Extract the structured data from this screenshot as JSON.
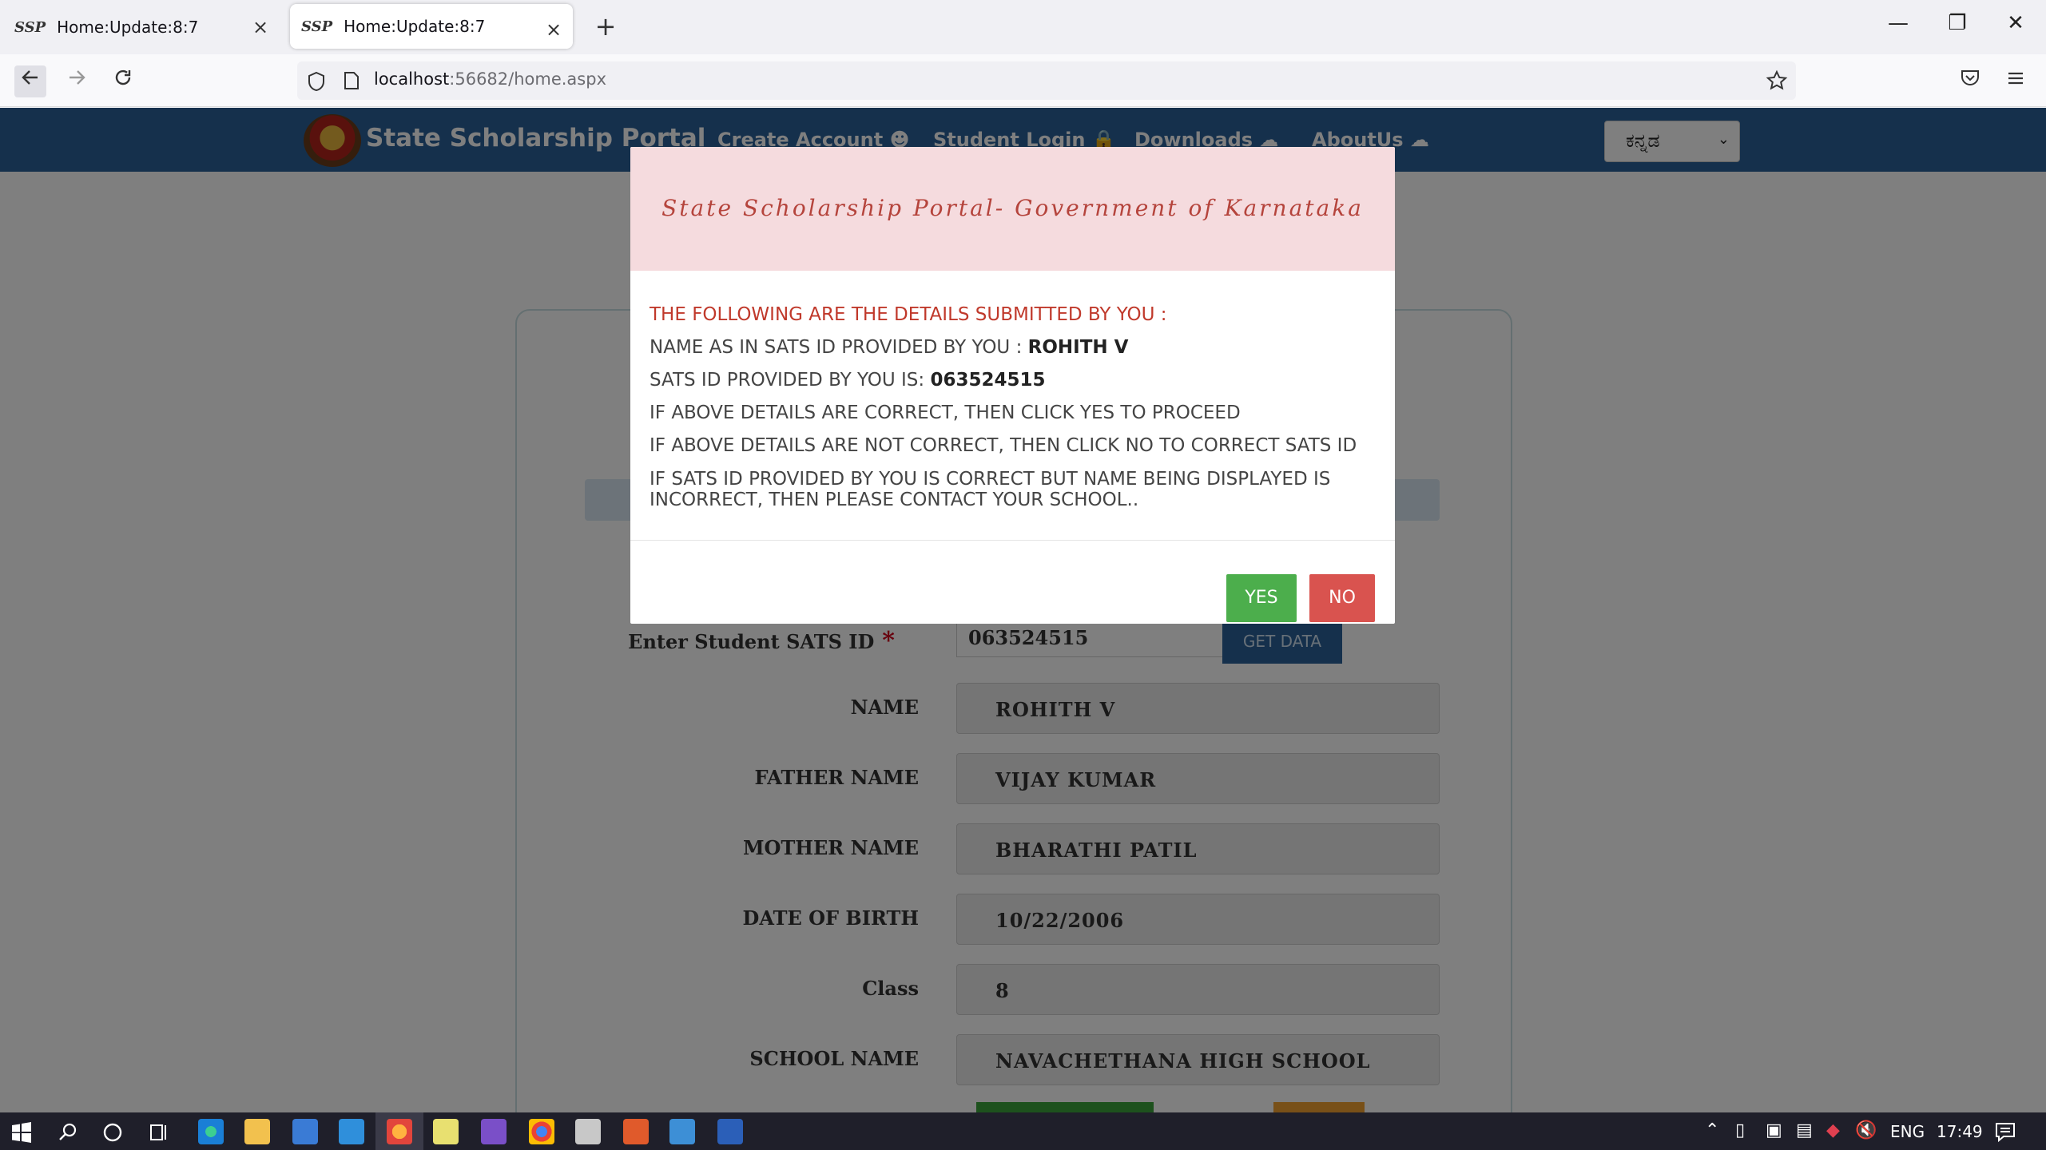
{
  "browser": {
    "tabs": [
      {
        "favicon": "SSP",
        "title": "Home:Update:8:7",
        "close": "×"
      },
      {
        "favicon": "SSP",
        "title": "Home:Update:8:7",
        "close": "×"
      }
    ],
    "new_tab": "+",
    "window": {
      "minimize": "—",
      "restore": "❐",
      "close": "✕"
    },
    "url_host": "localhost",
    "url_rest": ":56682/home.aspx"
  },
  "site": {
    "title": "State Scholarship Portal",
    "menu": [
      "Create Account",
      "Student Login",
      "Downloads",
      "AboutUs"
    ],
    "language": "ಕನ್ನಡ"
  },
  "form": {
    "sats_label": "Enter Student SATS ID",
    "required_mark": "*",
    "sats_value": "063524515",
    "get_data": "GET DATA",
    "fields": [
      {
        "label": "NAME",
        "value": "ROHITH  V"
      },
      {
        "label": "FATHER NAME",
        "value": "VIJAY KUMAR"
      },
      {
        "label": "MOTHER NAME",
        "value": "BHARATHI PATIL"
      },
      {
        "label": "DATE OF BIRTH",
        "value": "10/22/2006"
      },
      {
        "label": "Class",
        "value": "8"
      },
      {
        "label": "SCHOOL NAME",
        "value": "NAVACHETHANA HIGH SCHOOL"
      }
    ]
  },
  "modal": {
    "title": "State Scholarship Portal- Government of Karnataka",
    "line1": "THE FOLLOWING ARE THE DETAILS SUBMITTED BY YOU :",
    "line2_prefix": "NAME AS IN SATS ID PROVIDED BY YOU : ",
    "line2_value": "ROHITH V",
    "line3_prefix": "SATS ID PROVIDED BY YOU IS: ",
    "line3_value": "063524515",
    "line4": "IF ABOVE DETAILS ARE CORRECT, THEN CLICK YES TO PROCEED",
    "line5": "IF ABOVE DETAILS ARE NOT CORRECT, THEN CLICK NO TO CORRECT SATS ID",
    "line6": "IF SATS ID PROVIDED BY YOU IS CORRECT BUT NAME BEING DISPLAYED IS INCORRECT, THEN PLEASE CONTACT YOUR SCHOOL..",
    "yes": "YES",
    "no": "NO"
  },
  "taskbar": {
    "language": "ENG",
    "time": "17:49"
  },
  "colors": {
    "header": "#2a6199",
    "modal_head": "#f5dbde",
    "yes": "#4cae4c",
    "no": "#d9534f"
  }
}
